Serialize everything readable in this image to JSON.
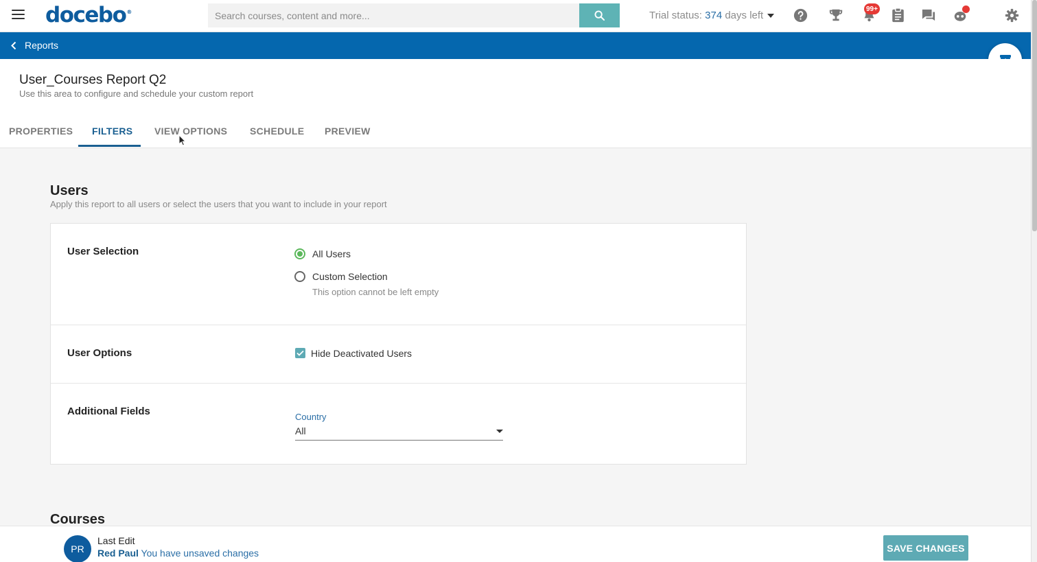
{
  "header": {
    "logo": "docebo",
    "search_placeholder": "Search courses, content and more...",
    "trial_prefix": "Trial status:",
    "trial_days": "374",
    "trial_suffix": "days left",
    "notification_badge": "99+"
  },
  "breadcrumb": {
    "back_label": "Reports"
  },
  "page": {
    "title": "User_Courses Report Q2",
    "subtitle": "Use this area to configure and schedule your custom report"
  },
  "tabs": [
    {
      "label": "PROPERTIES"
    },
    {
      "label": "FILTERS",
      "active": true
    },
    {
      "label": "VIEW OPTIONS"
    },
    {
      "label": "SCHEDULE"
    },
    {
      "label": "PREVIEW"
    }
  ],
  "users_section": {
    "title": "Users",
    "subtitle": "Apply this report to all users or select the users that you want to include in your report",
    "user_selection": {
      "label": "User Selection",
      "option_all": "All Users",
      "option_custom": "Custom Selection",
      "hint": "This option cannot be left empty",
      "selected": "All Users"
    },
    "user_options": {
      "label": "User Options",
      "hide_deactivated": "Hide Deactivated Users",
      "hide_deactivated_checked": true
    },
    "additional_fields": {
      "label": "Additional Fields",
      "country_label": "Country",
      "country_value": "All"
    }
  },
  "courses_section": {
    "title": "Courses"
  },
  "footer": {
    "avatar_initials": "PR",
    "last_edit_label": "Last Edit",
    "editor_name": "Red Paul",
    "status": "You have unsaved changes",
    "save_label": "SAVE CHANGES"
  },
  "colors": {
    "brand_blue": "#0567ae",
    "accent_teal": "#5eaab4",
    "radio_green": "#5cb85c",
    "badge_red": "#e53935"
  }
}
